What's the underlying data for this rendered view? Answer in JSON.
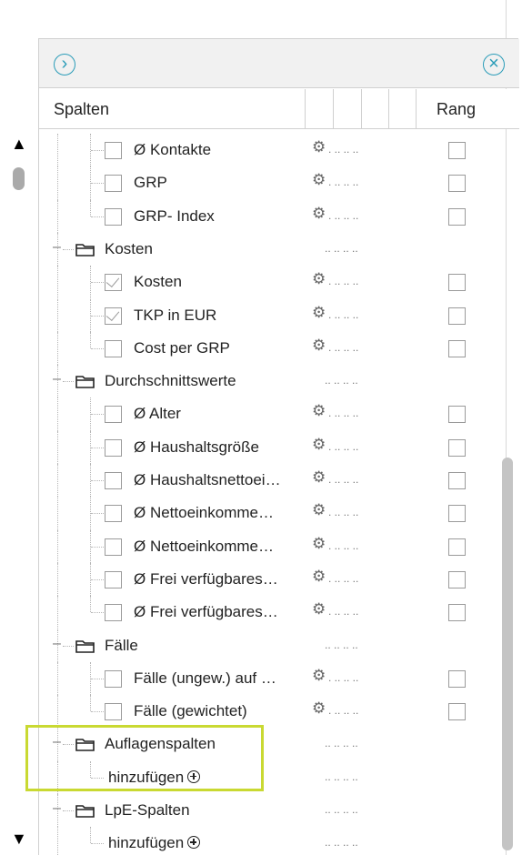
{
  "header": {
    "spalten_label": "Spalten",
    "rang_label": "Rang"
  },
  "rows": [
    {
      "kind": "item",
      "label": "Ø Kontakte",
      "checked": false,
      "gear": true,
      "rank": true
    },
    {
      "kind": "item",
      "label": "GRP",
      "checked": false,
      "gear": true,
      "rank": true
    },
    {
      "kind": "item",
      "label": "GRP- Index",
      "checked": false,
      "gear": true,
      "rank": true,
      "last": true
    },
    {
      "kind": "group",
      "label": "Kosten"
    },
    {
      "kind": "item",
      "label": "Kosten",
      "checked": true,
      "gear": true,
      "rank": true
    },
    {
      "kind": "item",
      "label": "TKP in EUR",
      "checked": true,
      "gear": true,
      "rank": true
    },
    {
      "kind": "item",
      "label": "Cost per GRP",
      "checked": false,
      "gear": true,
      "rank": true,
      "last": true
    },
    {
      "kind": "group",
      "label": "Durchschnittswerte"
    },
    {
      "kind": "item",
      "label": "Ø Alter",
      "checked": false,
      "gear": true,
      "rank": true
    },
    {
      "kind": "item",
      "label": "Ø Haushaltsgröße",
      "checked": false,
      "gear": true,
      "rank": true
    },
    {
      "kind": "item",
      "label": "Ø Haushaltsnettoei…",
      "checked": false,
      "gear": true,
      "rank": true
    },
    {
      "kind": "item",
      "label": "Ø Nettoeinkomme…",
      "checked": false,
      "gear": true,
      "rank": true
    },
    {
      "kind": "item",
      "label": "Ø Nettoeinkomme…",
      "checked": false,
      "gear": true,
      "rank": true
    },
    {
      "kind": "item",
      "label": "Ø Frei verfügbares…",
      "checked": false,
      "gear": true,
      "rank": true
    },
    {
      "kind": "item",
      "label": "Ø Frei verfügbares…",
      "checked": false,
      "gear": true,
      "rank": true,
      "last": true
    },
    {
      "kind": "group",
      "label": "Fälle"
    },
    {
      "kind": "item",
      "label": "Fälle (ungew.) auf …",
      "checked": false,
      "gear": true,
      "rank": true
    },
    {
      "kind": "item",
      "label": "Fälle (gewichtet)",
      "checked": false,
      "gear": true,
      "rank": true,
      "last": true
    },
    {
      "kind": "group",
      "label": "Auflagenspalten"
    },
    {
      "kind": "add",
      "label": "hinzufügen",
      "last": true
    },
    {
      "kind": "group",
      "label": "LpE-Spalten"
    },
    {
      "kind": "add",
      "label": "hinzufügen",
      "last": true
    }
  ],
  "scroll": {
    "up_glyph": "▲",
    "down_glyph": "▼"
  },
  "toolbar": {
    "expand_glyph": "›",
    "close_glyph": "×"
  },
  "colors": {
    "accent": "#2a9cb8",
    "highlight": "#c9d932"
  },
  "gear_glyph": "⚙",
  "dots_glyph": ". ..  ..  .."
}
